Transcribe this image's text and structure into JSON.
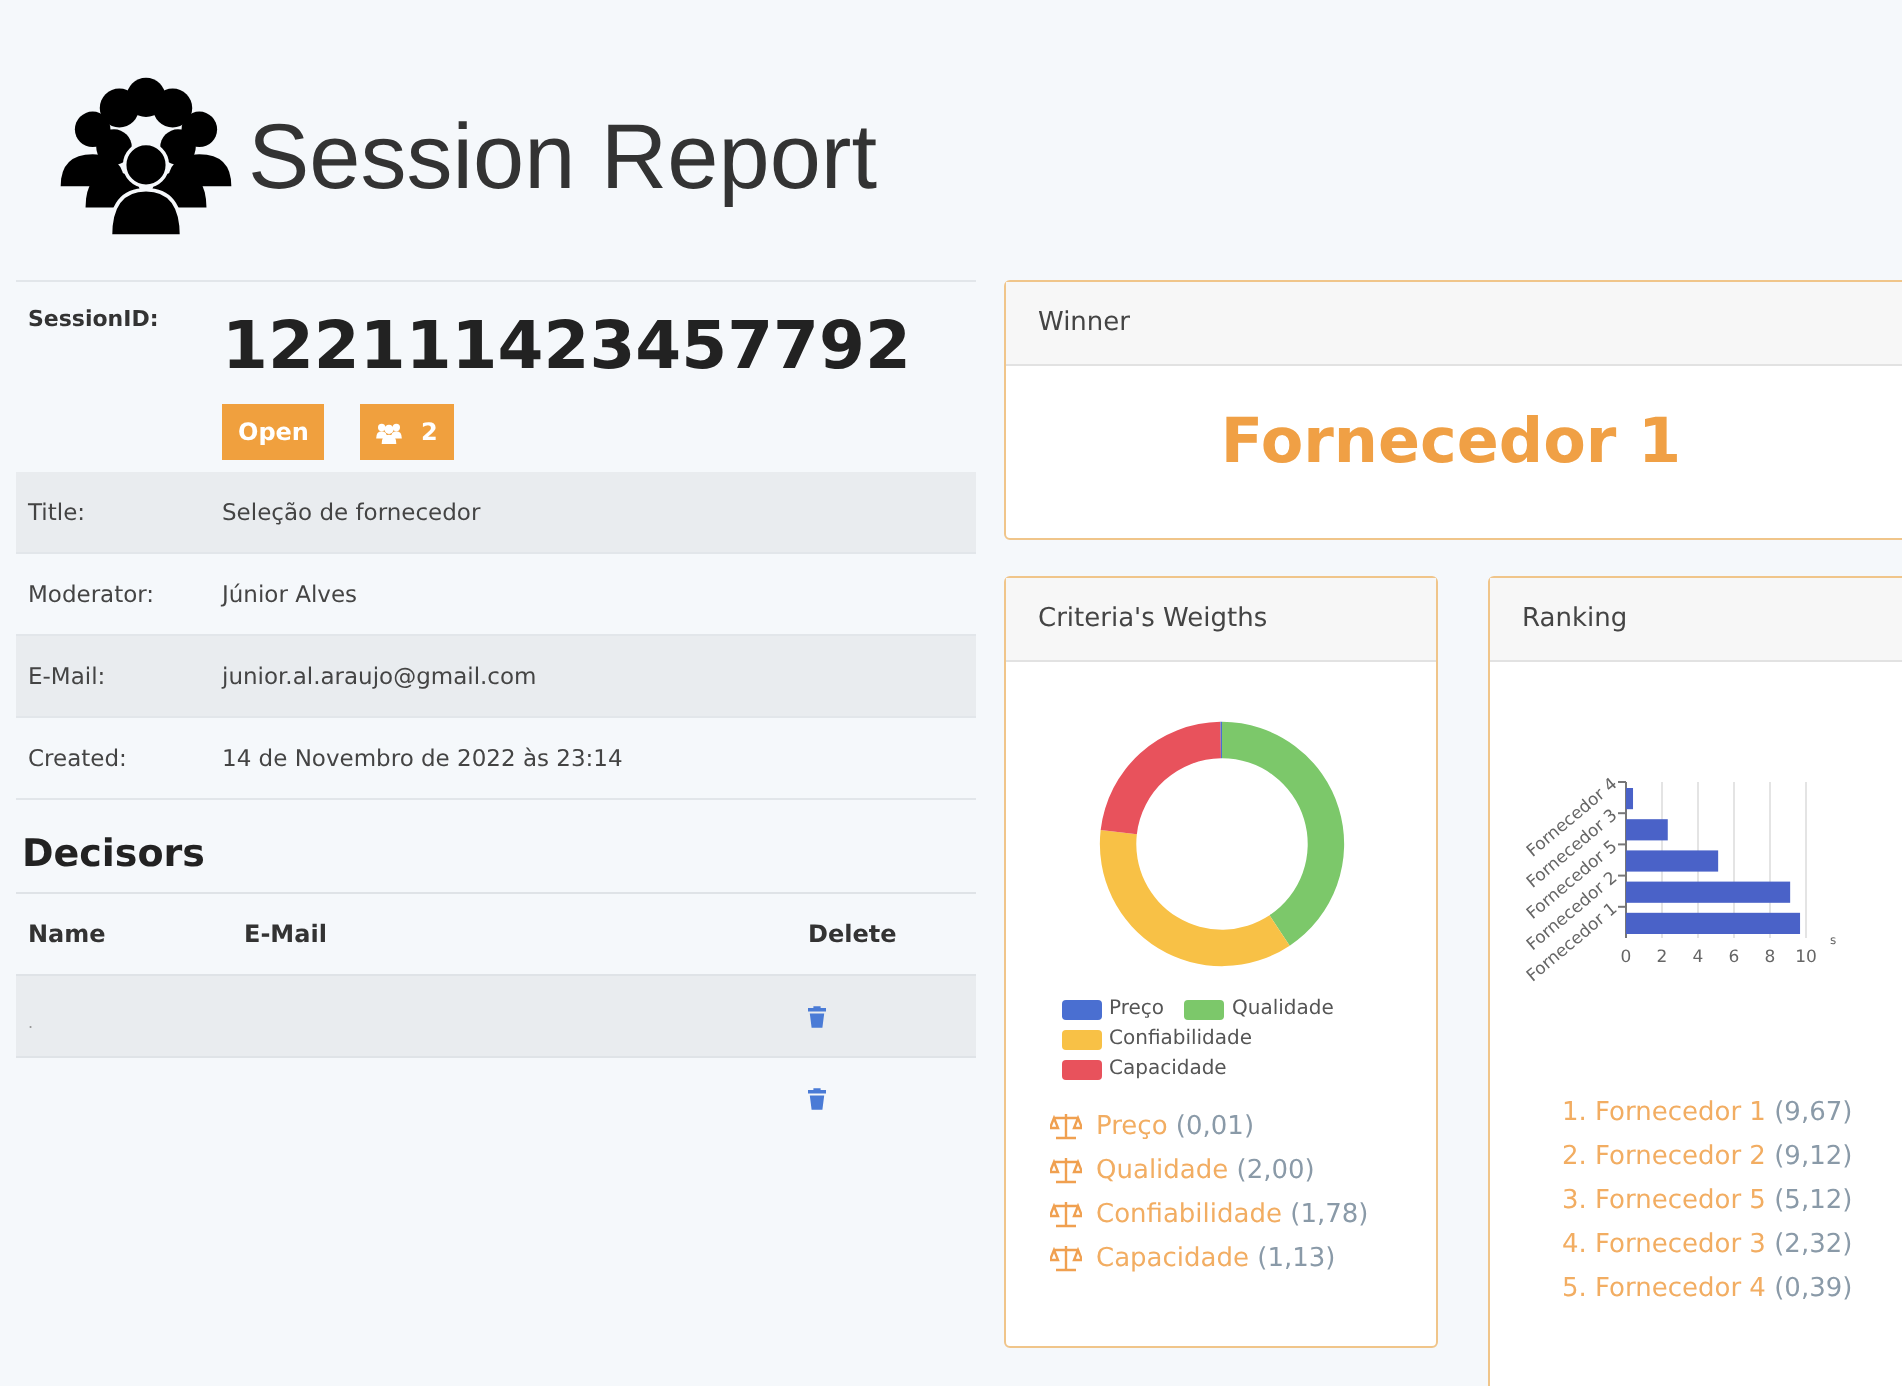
{
  "header": {
    "title": "Session Report"
  },
  "session": {
    "id_label": "SessionID:",
    "id": "122111423457792",
    "status": "Open",
    "members": "2",
    "fields": [
      {
        "label": "Title:",
        "value": "Seleção de fornecedor"
      },
      {
        "label": "Moderator:",
        "value": "Júnior Alves"
      },
      {
        "label": "E-Mail:",
        "value": "junior.al.araujo@gmail.com"
      },
      {
        "label": "Created:",
        "value": "14 de Novembro de 2022 às 23:14"
      }
    ]
  },
  "decisors": {
    "title": "Decisors",
    "columns": [
      "Name",
      "E-Mail",
      "Delete"
    ],
    "rows": [
      {
        "name": "."
      },
      {}
    ]
  },
  "winner": {
    "title": "Winner",
    "name": "Fornecedor 1"
  },
  "weights": {
    "title": "Criteria's Weigths",
    "chart_data": {
      "type": "donut",
      "legend": "bottom",
      "categories": [
        "Preço",
        "Qualidade",
        "Confiabilidade",
        "Capacidade"
      ],
      "values": [
        0.2,
        40.65,
        36.18,
        22.97
      ],
      "colors": [
        "#4a6fd1",
        "#7cc86a",
        "#f8c146",
        "#e8525c"
      ]
    },
    "items": [
      {
        "name": "Preço",
        "value": "(0,01)"
      },
      {
        "name": "Qualidade",
        "value": "(2,00)"
      },
      {
        "name": "Confiabilidade",
        "value": "(1,78)"
      },
      {
        "name": "Capacidade",
        "value": "(1,13)"
      }
    ]
  },
  "ranking": {
    "title": "Ranking",
    "chart_data": {
      "type": "bar",
      "orientation": "horizontal",
      "grid": true,
      "categories": [
        "Fornecedor 4",
        "Fornecedor 3",
        "Fornecedor 5",
        "Fornecedor 2",
        "Fornecedor 1"
      ],
      "xlabel": "s",
      "series": [
        {
          "color": "#4a62c8",
          "values": [
            0.39,
            2.32,
            5.12,
            9.12,
            9.67
          ]
        }
      ],
      "xticks": [
        0,
        2,
        4,
        6,
        8,
        10
      ],
      "xlim": [
        0,
        10
      ]
    },
    "items": [
      {
        "text": "1. Fornecedor 1",
        "value": "(9,67)"
      },
      {
        "text": "2. Fornecedor 2",
        "value": "(9,12)"
      },
      {
        "text": "3. Fornecedor 5",
        "value": "(5,12)"
      },
      {
        "text": "4. Fornecedor 3",
        "value": "(2,32)"
      },
      {
        "text": "5. Fornecedor 4",
        "value": "(0,39)"
      }
    ]
  }
}
